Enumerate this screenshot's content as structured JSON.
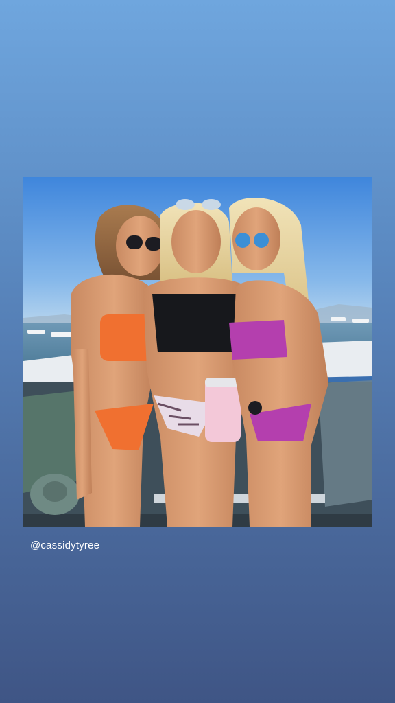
{
  "story": {
    "mention": "@cassidytyree"
  },
  "colors": {
    "background_top": "#6fa6de",
    "background_bottom": "#3f5585",
    "mention_text": "#ffffff"
  }
}
